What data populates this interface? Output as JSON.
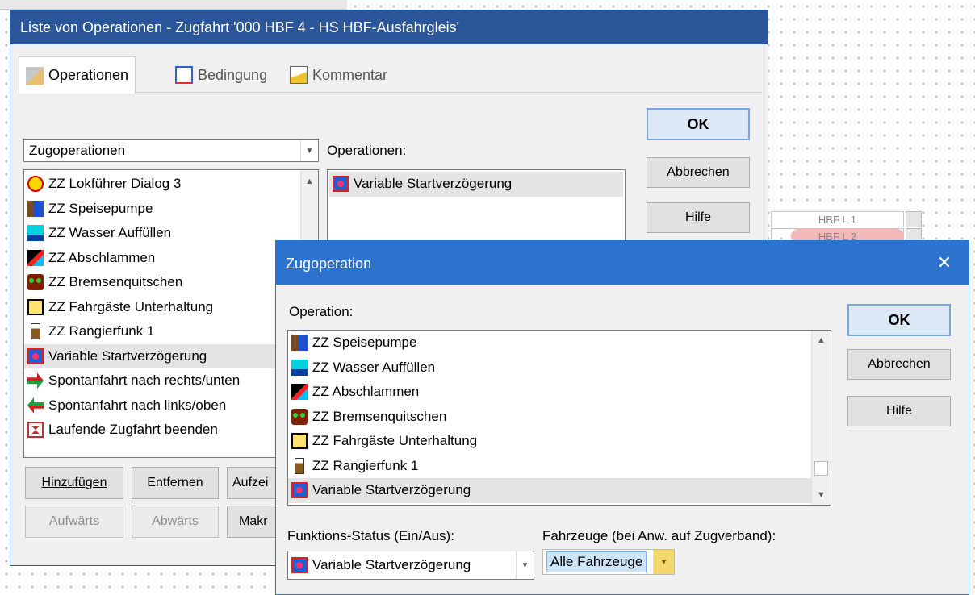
{
  "background": {
    "top_strip": "",
    "hbf_cells": [
      "HBF L 1",
      "HBF L 2"
    ]
  },
  "list_dialog": {
    "title": "Liste von Operationen - Zugfahrt '000 HBF 4 - HS HBF-Ausfahrgleis'",
    "tabs": [
      {
        "label": "Operationen",
        "icon": "operations-icon"
      },
      {
        "label": "Bedingung",
        "icon": "condition-icon"
      },
      {
        "label": "Kommentar",
        "icon": "comment-icon"
      }
    ],
    "category_combo": "Zugoperationen",
    "operations_label": "Operationen:",
    "available": [
      {
        "label": "ZZ Lokführer Dialog 3",
        "icon": "dialog-icon"
      },
      {
        "label": "ZZ Speisepumpe",
        "icon": "pump-icon"
      },
      {
        "label": "ZZ Wasser Auffüllen",
        "icon": "water-icon"
      },
      {
        "label": "ZZ Abschlammen",
        "icon": "blowdown-icon"
      },
      {
        "label": "ZZ Bremsenquitschen",
        "icon": "brake-icon"
      },
      {
        "label": "ZZ Fahrgäste Unterhaltung",
        "icon": "passengers-icon"
      },
      {
        "label": "ZZ Rangierfunk 1",
        "icon": "radio-icon"
      },
      {
        "label": "Variable Startverzögerung",
        "icon": "start-delay-icon"
      },
      {
        "label": "Spontanfahrt nach rechts/unten",
        "icon": "arrow-right-icon"
      },
      {
        "label": "Spontanfahrt nach links/oben",
        "icon": "arrow-left-icon"
      },
      {
        "label": "Laufende Zugfahrt beenden",
        "icon": "end-run-icon"
      }
    ],
    "selected": [
      {
        "label": "Variable Startverzögerung",
        "icon": "start-delay-icon"
      }
    ],
    "buttons": {
      "ok": "OK",
      "cancel": "Abbrechen",
      "help": "Hilfe",
      "add": "Hinzufügen",
      "remove": "Entfernen",
      "record": "Aufzei",
      "up": "Aufwärts",
      "down": "Abwärts",
      "macro": "Makr"
    }
  },
  "train_op_dialog": {
    "title": "Zugoperation",
    "close": "✕",
    "operation_label": "Operation:",
    "operations": [
      {
        "label": "ZZ Speisepumpe",
        "icon": "pump-icon"
      },
      {
        "label": "ZZ Wasser Auffüllen",
        "icon": "water-icon"
      },
      {
        "label": "ZZ Abschlammen",
        "icon": "blowdown-icon"
      },
      {
        "label": "ZZ Bremsenquitschen",
        "icon": "brake-icon"
      },
      {
        "label": "ZZ Fahrgäste Unterhaltung",
        "icon": "passengers-icon"
      },
      {
        "label": "ZZ Rangierfunk 1",
        "icon": "radio-icon"
      },
      {
        "label": "Variable Startverzögerung",
        "icon": "start-delay-icon"
      }
    ],
    "status_label": "Funktions-Status (Ein/Aus):",
    "status_value": "Variable Startverzögerung",
    "vehicles_label": "Fahrzeuge (bei Anw. auf Zugverband):",
    "vehicles_value": "Alle Fahrzeuge",
    "buttons": {
      "ok": "OK",
      "cancel": "Abbrechen",
      "help": "Hilfe"
    }
  }
}
